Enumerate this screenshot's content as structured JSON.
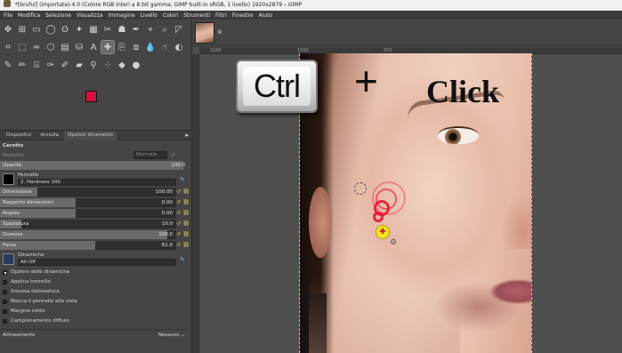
{
  "window": {
    "title": "*[bruful] (importata)-4.0 (Colore RGB interi a 8 bit gamma, GIMP built-in sRGB, 1 livello) 1920x2879 – GIMP"
  },
  "menu": [
    "File",
    "Modifica",
    "Selezione",
    "Visualizza",
    "Immagine",
    "Livello",
    "Colori",
    "Strumenti",
    "Filtri",
    "Finestre",
    "Aiuto"
  ],
  "toolbox": {
    "tools": [
      {
        "icon": "move-icon",
        "glyph": "✥"
      },
      {
        "icon": "align-icon",
        "glyph": "⊞"
      },
      {
        "icon": "rect-select-icon",
        "glyph": "▭"
      },
      {
        "icon": "ellipse-select-icon",
        "glyph": "◯"
      },
      {
        "icon": "lasso-icon",
        "glyph": "ʘ"
      },
      {
        "icon": "fuzzy-select-icon",
        "glyph": "✦"
      },
      {
        "icon": "select-by-color-icon",
        "glyph": "▦"
      },
      {
        "icon": "scissors-icon",
        "glyph": "✂"
      },
      {
        "icon": "foreground-select-icon",
        "glyph": "☗"
      },
      {
        "icon": "paths-icon",
        "glyph": "✒"
      },
      {
        "icon": "color-picker-icon",
        "glyph": "⌖"
      },
      {
        "icon": "zoom-icon",
        "glyph": "⌕"
      },
      {
        "icon": "measure-icon",
        "glyph": "◸"
      },
      {
        "icon": "crop-icon",
        "glyph": "⌗"
      },
      {
        "icon": "unified-transform-icon",
        "glyph": "⬚"
      },
      {
        "icon": "warp-icon",
        "glyph": "≈"
      },
      {
        "icon": "cage-icon",
        "glyph": "⬡"
      },
      {
        "icon": "gradient-icon",
        "glyph": "▤"
      },
      {
        "icon": "bucket-fill-icon",
        "glyph": "⛁"
      },
      {
        "icon": "text-icon",
        "glyph": "A"
      },
      {
        "icon": "heal-icon",
        "glyph": "✚"
      },
      {
        "icon": "clone-icon",
        "glyph": "⎘"
      },
      {
        "icon": "perspective-clone-icon",
        "glyph": "⧈"
      },
      {
        "icon": "blur-icon",
        "glyph": "💧"
      },
      {
        "icon": "smudge-icon",
        "glyph": "☝"
      },
      {
        "icon": "dodge-burn-icon",
        "glyph": "◐"
      },
      {
        "icon": "paintbrush-icon",
        "glyph": "✎"
      },
      {
        "icon": "pencil-icon",
        "glyph": "✏"
      },
      {
        "icon": "airbrush-icon",
        "glyph": "⍓"
      },
      {
        "icon": "ink-icon",
        "glyph": "✑"
      },
      {
        "icon": "mypaint-icon",
        "glyph": "✐"
      },
      {
        "icon": "eraser-icon",
        "glyph": "▰"
      },
      {
        "icon": "fuzzy-icon",
        "glyph": "⚲"
      },
      {
        "icon": "dots-icon",
        "glyph": "⁘"
      },
      {
        "icon": "gegl-icon",
        "glyph": "◆"
      },
      {
        "icon": "sphere-icon",
        "glyph": "●"
      }
    ],
    "fg_color": "#d5103b",
    "bg_color": "#ffffff"
  },
  "dock": {
    "tabs": [
      {
        "icon": "brush-tab-icon",
        "label": "Dispositivi"
      },
      {
        "icon": "undo-tab-icon",
        "label": "Annulla"
      },
      {
        "icon": "options-tab-icon",
        "label": "Opzioni strumento"
      }
    ],
    "tool_name": "Cerotto",
    "mode_label": "Modalità",
    "mode_value": "Normale",
    "opacity_label": "Opacità",
    "opacity_value": "100.0",
    "brush_label": "Pennello",
    "brush_value": "2. Hardness 100",
    "sliders": [
      {
        "label": "Dimensione",
        "value": "100.00",
        "fraction": 0.21
      },
      {
        "label": "Rapporto dimensioni",
        "value": "0.00",
        "fraction": 0.43
      },
      {
        "label": "Angolo",
        "value": "0.00",
        "fraction": 0.43
      },
      {
        "label": "Spaziatura",
        "value": "10.0",
        "fraction": 0.12
      },
      {
        "label": "Durezza",
        "value": "100.0",
        "fraction": 0.95
      },
      {
        "label": "Forza",
        "value": "61.0",
        "fraction": 0.54
      }
    ],
    "dynamics_label": "Dinamiche",
    "dynamics_value": "All-Off",
    "checks": [
      {
        "label": "Opzioni delle dinamiche",
        "checked": true
      },
      {
        "label": "Applica tremolio",
        "checked": false
      },
      {
        "label": "Smussa delineatura",
        "checked": false
      },
      {
        "label": "Blocca il pennello alla vista",
        "checked": false
      },
      {
        "label": "Margine netto",
        "checked": false
      },
      {
        "label": "Campionamento diffuso",
        "checked": false
      }
    ],
    "alignment_label": "Allineamento",
    "alignment_value": "Nessuno"
  },
  "canvas": {
    "ruler_labels": [
      "1500",
      "1000",
      "500"
    ],
    "overlay": {
      "key": "Ctrl",
      "plus": "+",
      "action": "Click"
    },
    "brush_color": "#e6143a"
  }
}
